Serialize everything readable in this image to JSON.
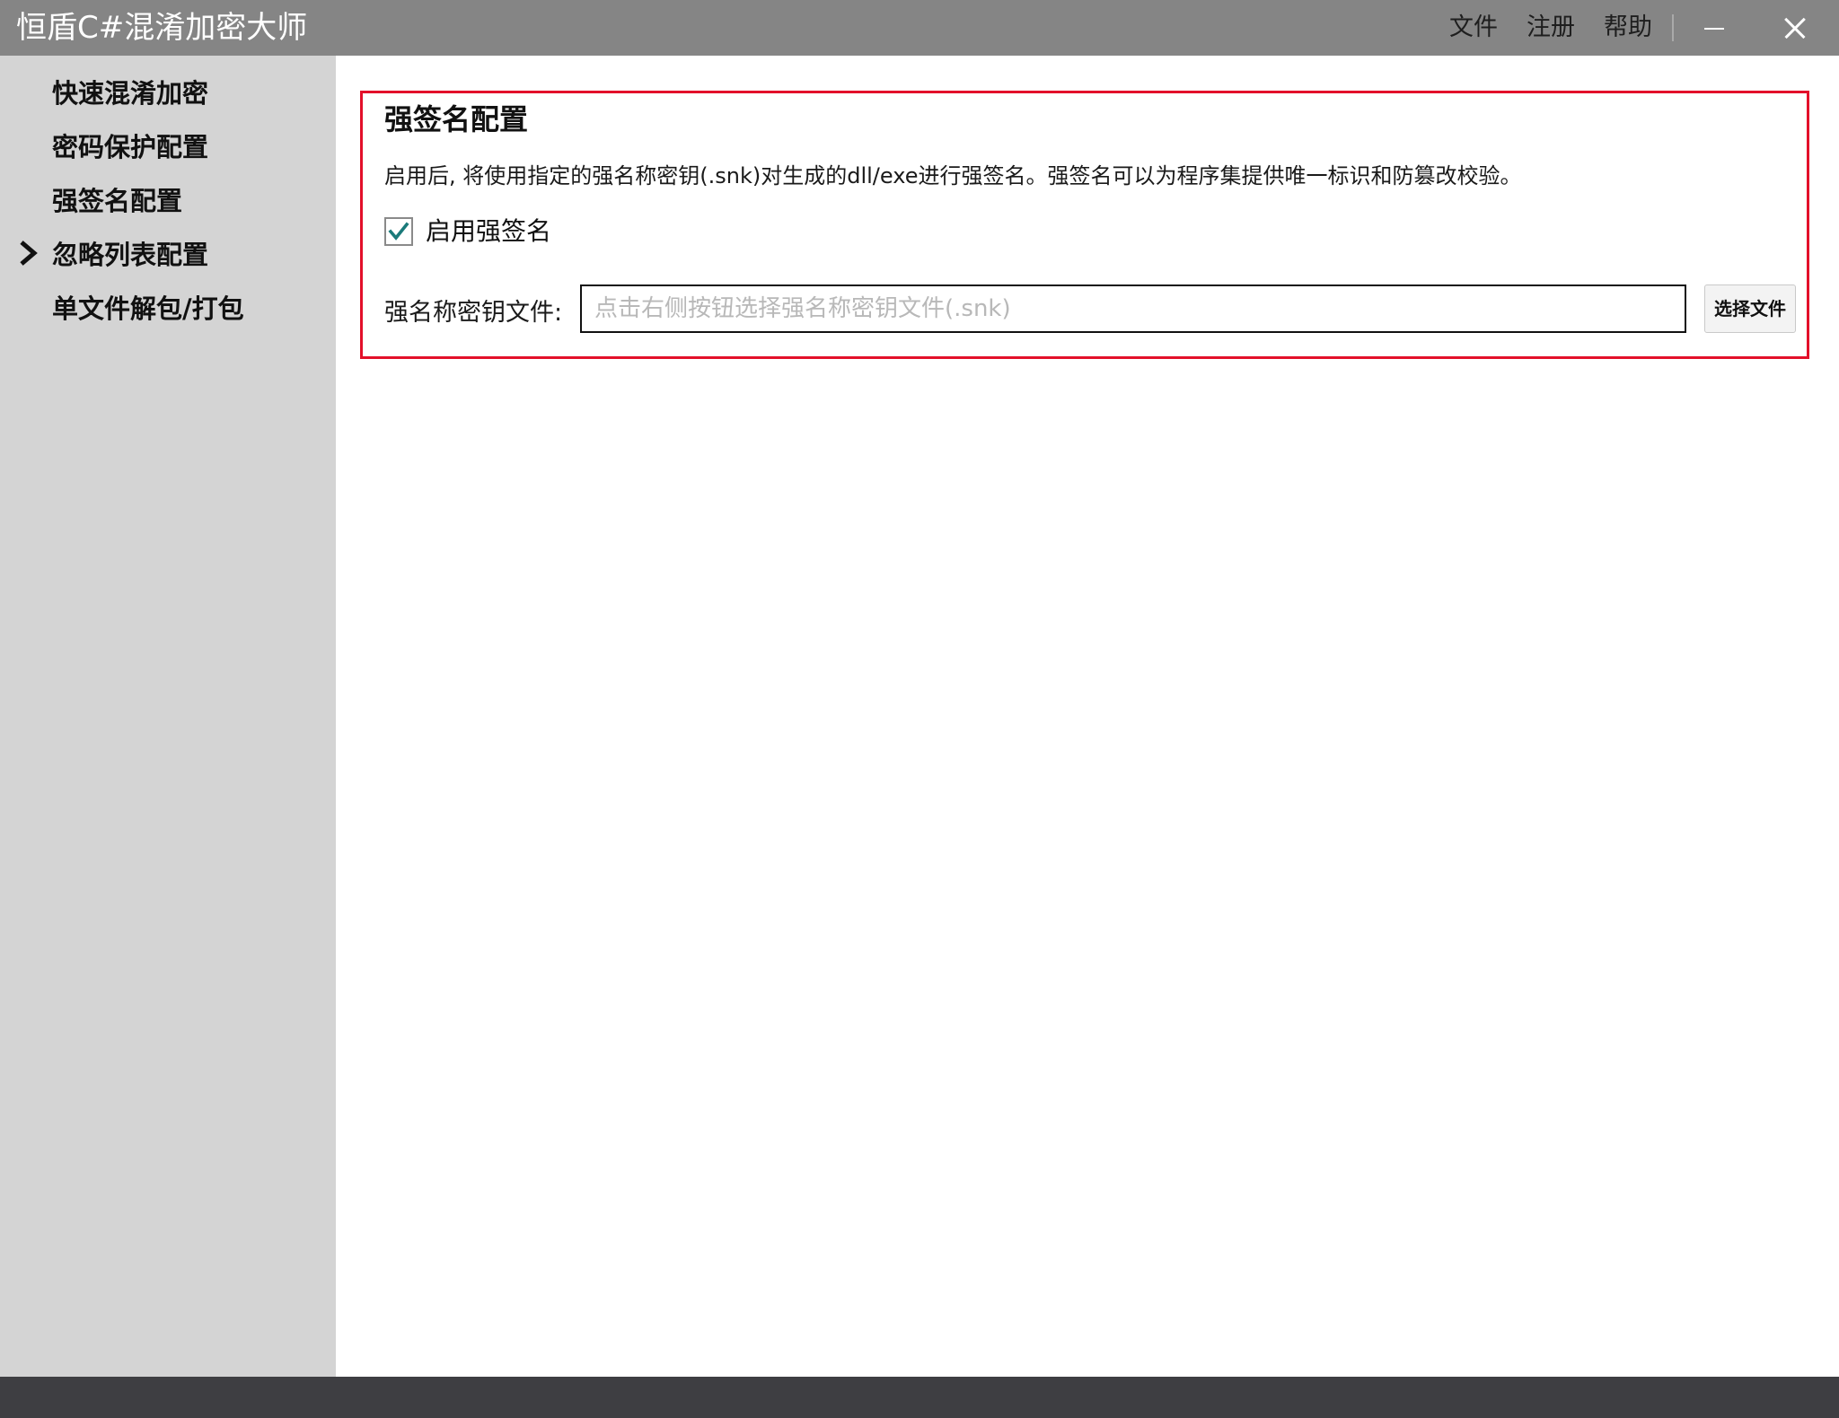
{
  "window": {
    "title": "恒盾C#混淆加密大师",
    "menu": {
      "file": "文件",
      "register": "注册",
      "help": "帮助"
    },
    "controls": {
      "minimize_icon": "minimize-icon",
      "close_icon": "close-icon"
    }
  },
  "sidebar": {
    "items": [
      {
        "label": "快速混淆加密",
        "active": false
      },
      {
        "label": "密码保护配置",
        "active": false
      },
      {
        "label": "强签名配置",
        "active": true
      },
      {
        "label": "忽略列表配置",
        "active": false
      },
      {
        "label": "单文件解包/打包",
        "active": false
      }
    ],
    "active_indicator_icon": "chevron-right-icon"
  },
  "main": {
    "section_title": "强签名配置",
    "description": "启用后, 将使用指定的强名称密钥(.snk)对生成的dll/exe进行强签名。强签名可以为程序集提供唯一标识和防篡改校验。",
    "enable_checkbox": {
      "label": "启用强签名",
      "checked": true
    },
    "key_file": {
      "label": "强名称密钥文件:",
      "value": "",
      "placeholder": "点击右侧按钮选择强名称密钥文件(.snk)"
    },
    "choose_button_label": "选择文件"
  },
  "colors": {
    "titlebar_bg": "#858585",
    "sidebar_bg": "#d4d4d4",
    "statusbar_bg": "#3e3e42",
    "highlight_border": "#e3102a",
    "checkmark": "#1a7a7a"
  }
}
